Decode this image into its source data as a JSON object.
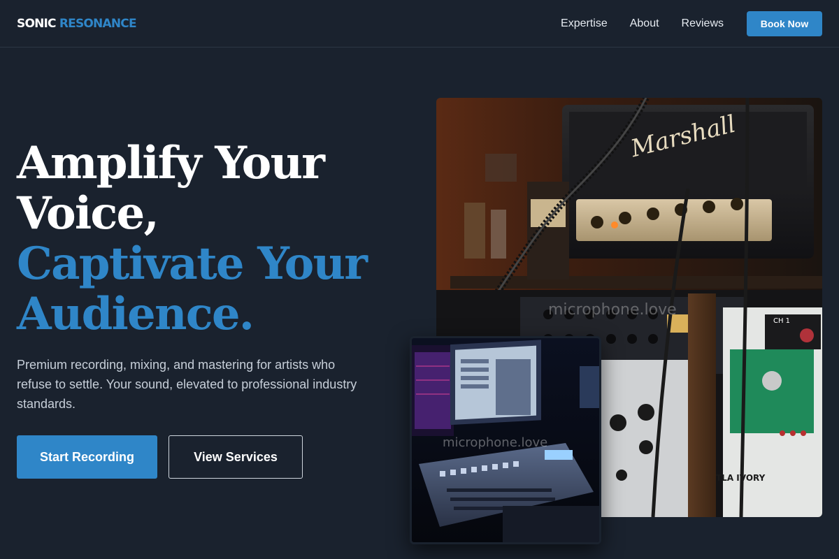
{
  "brand": {
    "part1": "SONIC",
    "part2": "RESONANCE"
  },
  "nav": {
    "items": [
      "Expertise",
      "About",
      "Reviews"
    ],
    "cta": "Book Now"
  },
  "hero": {
    "headline_line1": "Amplify Your",
    "headline_line2": "Voice,",
    "headline_line3": "Captivate Your",
    "headline_line4": "Audience.",
    "subtext": "Premium recording, mixing, and mastering for artists who refuse to settle. Your sound, elevated to professional industry standards.",
    "primary_button": "Start Recording",
    "secondary_button": "View Services"
  },
  "images": {
    "main_watermark": "microphone.love",
    "secondary_watermark": "microphone.love",
    "amp_brand": "Marshall",
    "channel_label": "CH 1",
    "unit_label": "TLA IVORY"
  },
  "colors": {
    "background": "#1a222e",
    "accent": "#2f86c8",
    "text": "#ffffff",
    "muted_text": "#c7cfd9"
  }
}
